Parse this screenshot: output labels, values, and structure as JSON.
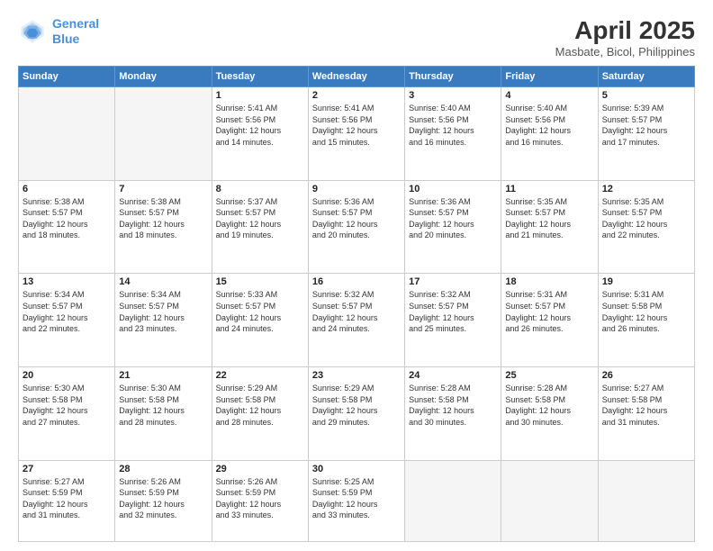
{
  "header": {
    "logo_line1": "General",
    "logo_line2": "Blue",
    "title": "April 2025",
    "subtitle": "Masbate, Bicol, Philippines"
  },
  "calendar": {
    "days_of_week": [
      "Sunday",
      "Monday",
      "Tuesday",
      "Wednesday",
      "Thursday",
      "Friday",
      "Saturday"
    ],
    "weeks": [
      [
        {
          "num": "",
          "info": ""
        },
        {
          "num": "",
          "info": ""
        },
        {
          "num": "1",
          "info": "Sunrise: 5:41 AM\nSunset: 5:56 PM\nDaylight: 12 hours\nand 14 minutes."
        },
        {
          "num": "2",
          "info": "Sunrise: 5:41 AM\nSunset: 5:56 PM\nDaylight: 12 hours\nand 15 minutes."
        },
        {
          "num": "3",
          "info": "Sunrise: 5:40 AM\nSunset: 5:56 PM\nDaylight: 12 hours\nand 16 minutes."
        },
        {
          "num": "4",
          "info": "Sunrise: 5:40 AM\nSunset: 5:56 PM\nDaylight: 12 hours\nand 16 minutes."
        },
        {
          "num": "5",
          "info": "Sunrise: 5:39 AM\nSunset: 5:57 PM\nDaylight: 12 hours\nand 17 minutes."
        }
      ],
      [
        {
          "num": "6",
          "info": "Sunrise: 5:38 AM\nSunset: 5:57 PM\nDaylight: 12 hours\nand 18 minutes."
        },
        {
          "num": "7",
          "info": "Sunrise: 5:38 AM\nSunset: 5:57 PM\nDaylight: 12 hours\nand 18 minutes."
        },
        {
          "num": "8",
          "info": "Sunrise: 5:37 AM\nSunset: 5:57 PM\nDaylight: 12 hours\nand 19 minutes."
        },
        {
          "num": "9",
          "info": "Sunrise: 5:36 AM\nSunset: 5:57 PM\nDaylight: 12 hours\nand 20 minutes."
        },
        {
          "num": "10",
          "info": "Sunrise: 5:36 AM\nSunset: 5:57 PM\nDaylight: 12 hours\nand 20 minutes."
        },
        {
          "num": "11",
          "info": "Sunrise: 5:35 AM\nSunset: 5:57 PM\nDaylight: 12 hours\nand 21 minutes."
        },
        {
          "num": "12",
          "info": "Sunrise: 5:35 AM\nSunset: 5:57 PM\nDaylight: 12 hours\nand 22 minutes."
        }
      ],
      [
        {
          "num": "13",
          "info": "Sunrise: 5:34 AM\nSunset: 5:57 PM\nDaylight: 12 hours\nand 22 minutes."
        },
        {
          "num": "14",
          "info": "Sunrise: 5:34 AM\nSunset: 5:57 PM\nDaylight: 12 hours\nand 23 minutes."
        },
        {
          "num": "15",
          "info": "Sunrise: 5:33 AM\nSunset: 5:57 PM\nDaylight: 12 hours\nand 24 minutes."
        },
        {
          "num": "16",
          "info": "Sunrise: 5:32 AM\nSunset: 5:57 PM\nDaylight: 12 hours\nand 24 minutes."
        },
        {
          "num": "17",
          "info": "Sunrise: 5:32 AM\nSunset: 5:57 PM\nDaylight: 12 hours\nand 25 minutes."
        },
        {
          "num": "18",
          "info": "Sunrise: 5:31 AM\nSunset: 5:57 PM\nDaylight: 12 hours\nand 26 minutes."
        },
        {
          "num": "19",
          "info": "Sunrise: 5:31 AM\nSunset: 5:58 PM\nDaylight: 12 hours\nand 26 minutes."
        }
      ],
      [
        {
          "num": "20",
          "info": "Sunrise: 5:30 AM\nSunset: 5:58 PM\nDaylight: 12 hours\nand 27 minutes."
        },
        {
          "num": "21",
          "info": "Sunrise: 5:30 AM\nSunset: 5:58 PM\nDaylight: 12 hours\nand 28 minutes."
        },
        {
          "num": "22",
          "info": "Sunrise: 5:29 AM\nSunset: 5:58 PM\nDaylight: 12 hours\nand 28 minutes."
        },
        {
          "num": "23",
          "info": "Sunrise: 5:29 AM\nSunset: 5:58 PM\nDaylight: 12 hours\nand 29 minutes."
        },
        {
          "num": "24",
          "info": "Sunrise: 5:28 AM\nSunset: 5:58 PM\nDaylight: 12 hours\nand 30 minutes."
        },
        {
          "num": "25",
          "info": "Sunrise: 5:28 AM\nSunset: 5:58 PM\nDaylight: 12 hours\nand 30 minutes."
        },
        {
          "num": "26",
          "info": "Sunrise: 5:27 AM\nSunset: 5:58 PM\nDaylight: 12 hours\nand 31 minutes."
        }
      ],
      [
        {
          "num": "27",
          "info": "Sunrise: 5:27 AM\nSunset: 5:59 PM\nDaylight: 12 hours\nand 31 minutes."
        },
        {
          "num": "28",
          "info": "Sunrise: 5:26 AM\nSunset: 5:59 PM\nDaylight: 12 hours\nand 32 minutes."
        },
        {
          "num": "29",
          "info": "Sunrise: 5:26 AM\nSunset: 5:59 PM\nDaylight: 12 hours\nand 33 minutes."
        },
        {
          "num": "30",
          "info": "Sunrise: 5:25 AM\nSunset: 5:59 PM\nDaylight: 12 hours\nand 33 minutes."
        },
        {
          "num": "",
          "info": ""
        },
        {
          "num": "",
          "info": ""
        },
        {
          "num": "",
          "info": ""
        }
      ]
    ]
  }
}
